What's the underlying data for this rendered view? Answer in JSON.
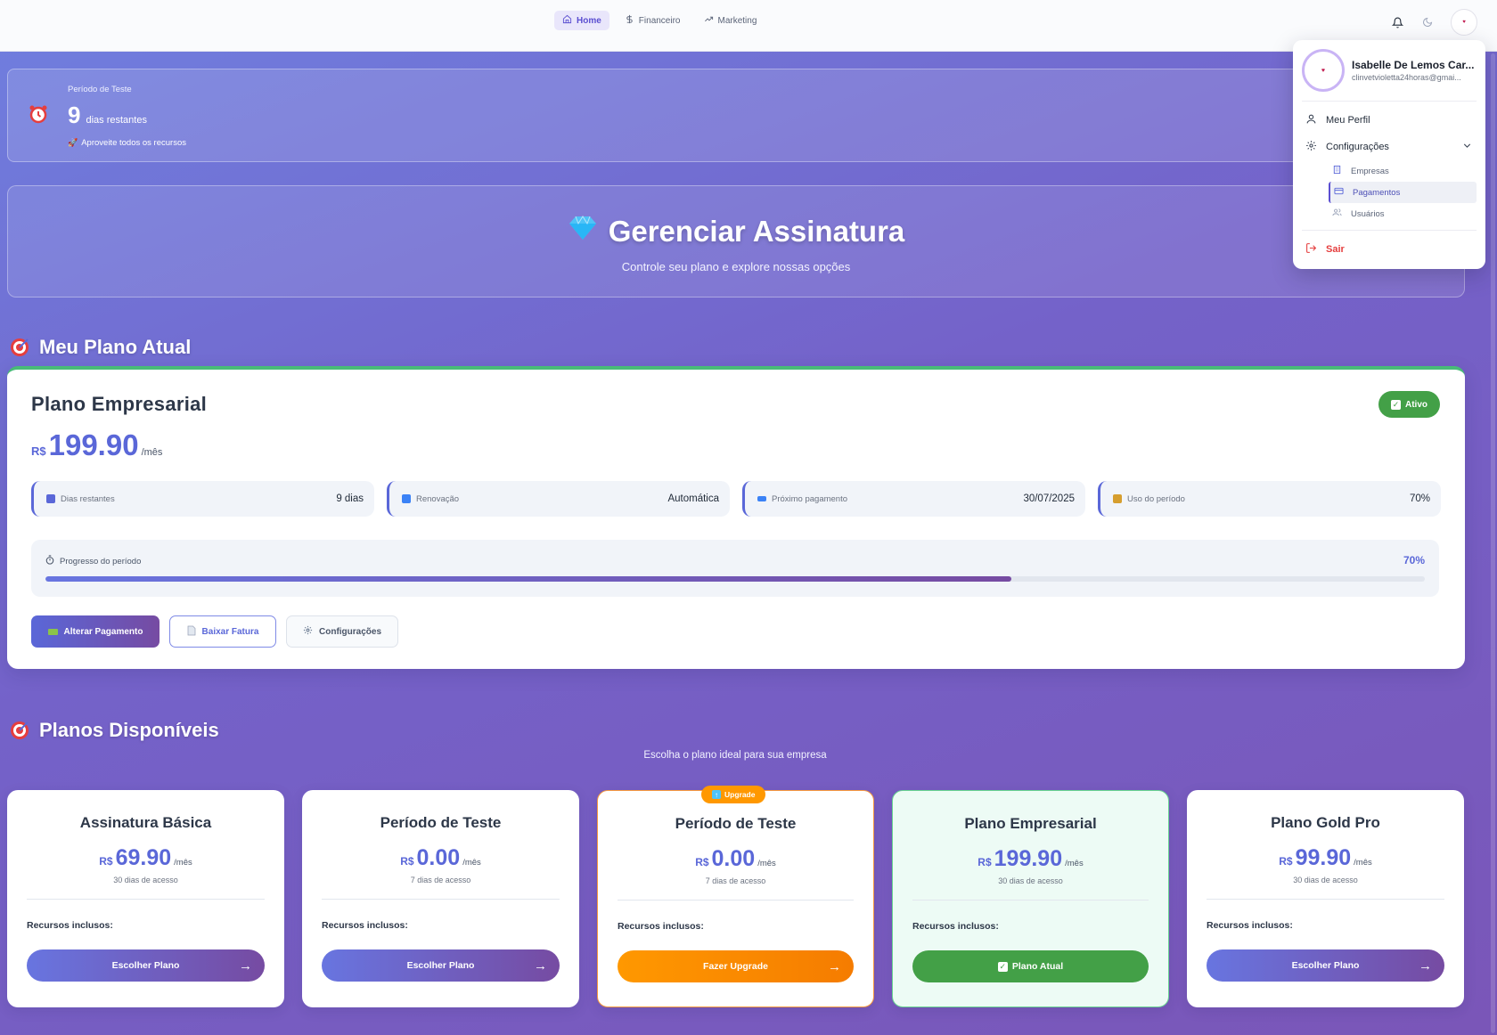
{
  "nav": {
    "items": [
      {
        "label": "Home",
        "icon": "home-icon",
        "active": true
      },
      {
        "label": "Financeiro",
        "icon": "dollar-icon",
        "active": false
      },
      {
        "label": "Marketing",
        "icon": "trending-up-icon",
        "active": false
      }
    ]
  },
  "user_menu": {
    "name": "Isabelle De Lemos Car...",
    "email": "clinvetvioletta24horas@gmai...",
    "profile_label": "Meu Perfil",
    "settings_label": "Configurações",
    "sub_items": [
      {
        "label": "Empresas",
        "icon": "building-icon"
      },
      {
        "label": "Pagamentos",
        "icon": "card-icon",
        "active": true
      },
      {
        "label": "Usuários",
        "icon": "users-icon"
      }
    ],
    "logout_label": "Sair"
  },
  "trial": {
    "label": "Período de Teste",
    "days": "9",
    "days_text": "dias restantes",
    "note": "Aproveite todos os recursos"
  },
  "hero": {
    "title": "Gerenciar Assinatura",
    "subtitle": "Controle seu plano e explore nossas opções"
  },
  "current_plan": {
    "section_title": "Meu Plano Atual",
    "name": "Plano Empresarial",
    "currency": "R$",
    "price": "199.90",
    "period": "/mês",
    "status": "Ativo",
    "stats": [
      {
        "label": "Dias restantes",
        "value": "9 dias",
        "color": "#5a67d8"
      },
      {
        "label": "Renovação",
        "value": "Automática",
        "color": "#3b82f6"
      },
      {
        "label": "Próximo pagamento",
        "value": "30/07/2025",
        "color": "#3b82f6"
      },
      {
        "label": "Uso do período",
        "value": "70%",
        "color": "#d69e2e"
      }
    ],
    "progress_label": "Progresso do período",
    "progress_text": "70%",
    "progress": 0.7,
    "buttons": {
      "change_payment": "Alterar Pagamento",
      "download_invoice": "Baixar Fatura",
      "settings": "Configurações"
    }
  },
  "available": {
    "section_title": "Planos Disponíveis",
    "subtitle": "Escolha o plano ideal para sua empresa",
    "features_label": "Recursos inclusos:",
    "plans": [
      {
        "name": "Assinatura Básica",
        "currency": "R$",
        "price": "69.90",
        "period": "/mês",
        "duration": "30 dias de acesso",
        "button": "Escolher Plano",
        "arrow": "→"
      },
      {
        "name": "Período de Teste",
        "currency": "R$",
        "price": "0.00",
        "period": "/mês",
        "duration": "7 dias de acesso",
        "button": "Escolher Plano",
        "arrow": "→"
      },
      {
        "name": "Período de Teste",
        "currency": "R$",
        "price": "0.00",
        "period": "/mês",
        "duration": "7 dias de acesso",
        "button": "Fazer Upgrade",
        "arrow": "→",
        "badge": "Upgrade"
      },
      {
        "name": "Plano Empresarial",
        "currency": "R$",
        "price": "199.90",
        "period": "/mês",
        "duration": "30 dias de acesso",
        "button": "Plano Atual"
      },
      {
        "name": "Plano Gold Pro",
        "currency": "R$",
        "price": "99.90",
        "period": "/mês",
        "duration": "30 dias de acesso",
        "button": "Escolher Plano",
        "arrow": "→"
      }
    ]
  },
  "colors": {
    "accent": "#5a67d8",
    "success": "#43a047",
    "upgrade": "#ff9800",
    "danger": "#e53e3e"
  }
}
